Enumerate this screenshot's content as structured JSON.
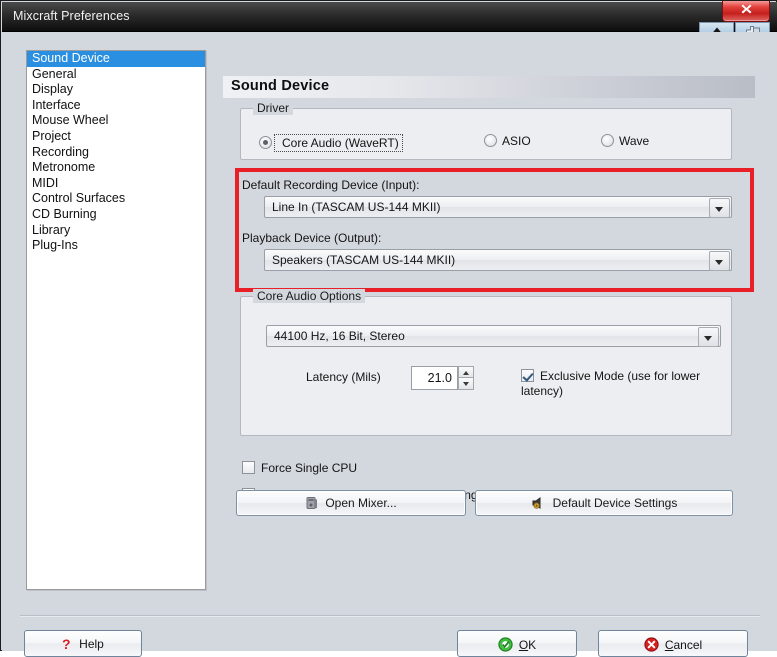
{
  "window": {
    "title": "Mixcraft Preferences",
    "close_label": "✕",
    "collapse_icon": "triangle-up-icon",
    "pin_icon": "pushpin-icon"
  },
  "sidebar": {
    "items": [
      {
        "label": "Sound Device",
        "selected": true
      },
      {
        "label": "General",
        "selected": false
      },
      {
        "label": "Display",
        "selected": false
      },
      {
        "label": "Interface",
        "selected": false
      },
      {
        "label": "Mouse Wheel",
        "selected": false
      },
      {
        "label": "Project",
        "selected": false
      },
      {
        "label": "Recording",
        "selected": false
      },
      {
        "label": "Metronome",
        "selected": false
      },
      {
        "label": "MIDI",
        "selected": false
      },
      {
        "label": "Control Surfaces",
        "selected": false
      },
      {
        "label": "CD Burning",
        "selected": false
      },
      {
        "label": "Library",
        "selected": false
      },
      {
        "label": "Plug-Ins",
        "selected": false
      }
    ]
  },
  "pane": {
    "header": "Sound Device",
    "driver_group": {
      "title": "Driver",
      "options": [
        {
          "label": "Core Audio (WaveRT)",
          "selected": true
        },
        {
          "label": "ASIO",
          "selected": false
        },
        {
          "label": "Wave",
          "selected": false
        }
      ]
    },
    "devices": {
      "input_label": "Default Recording Device (Input):",
      "input_value": "Line In (TASCAM US-144 MKII)",
      "output_label": "Playback Device (Output):",
      "output_value": "Speakers (TASCAM US-144 MKII)",
      "highlight_color": "#e81f26"
    },
    "core_audio_group": {
      "title": "Core Audio Options",
      "format_value": "44100 Hz, 16 Bit, Stereo",
      "latency_label": "Latency (Mils)",
      "latency_value": "21.0",
      "exclusive_label": "Exclusive Mode (use for lower latency)",
      "exclusive_checked": true
    },
    "checkboxes": [
      {
        "label": "Force Single CPU",
        "checked": false
      },
      {
        "label": "Use High Priority Threads For Audio Engine",
        "checked": true
      }
    ],
    "buttons": {
      "open_mixer": "Open Mixer...",
      "default_device_settings": "Default Device Settings"
    }
  },
  "footer": {
    "help": "Help",
    "ok": "OK",
    "ok_accel": "O",
    "ok_rest": "K",
    "cancel": "Cancel",
    "cancel_accel": "C",
    "cancel_rest": "ancel"
  }
}
